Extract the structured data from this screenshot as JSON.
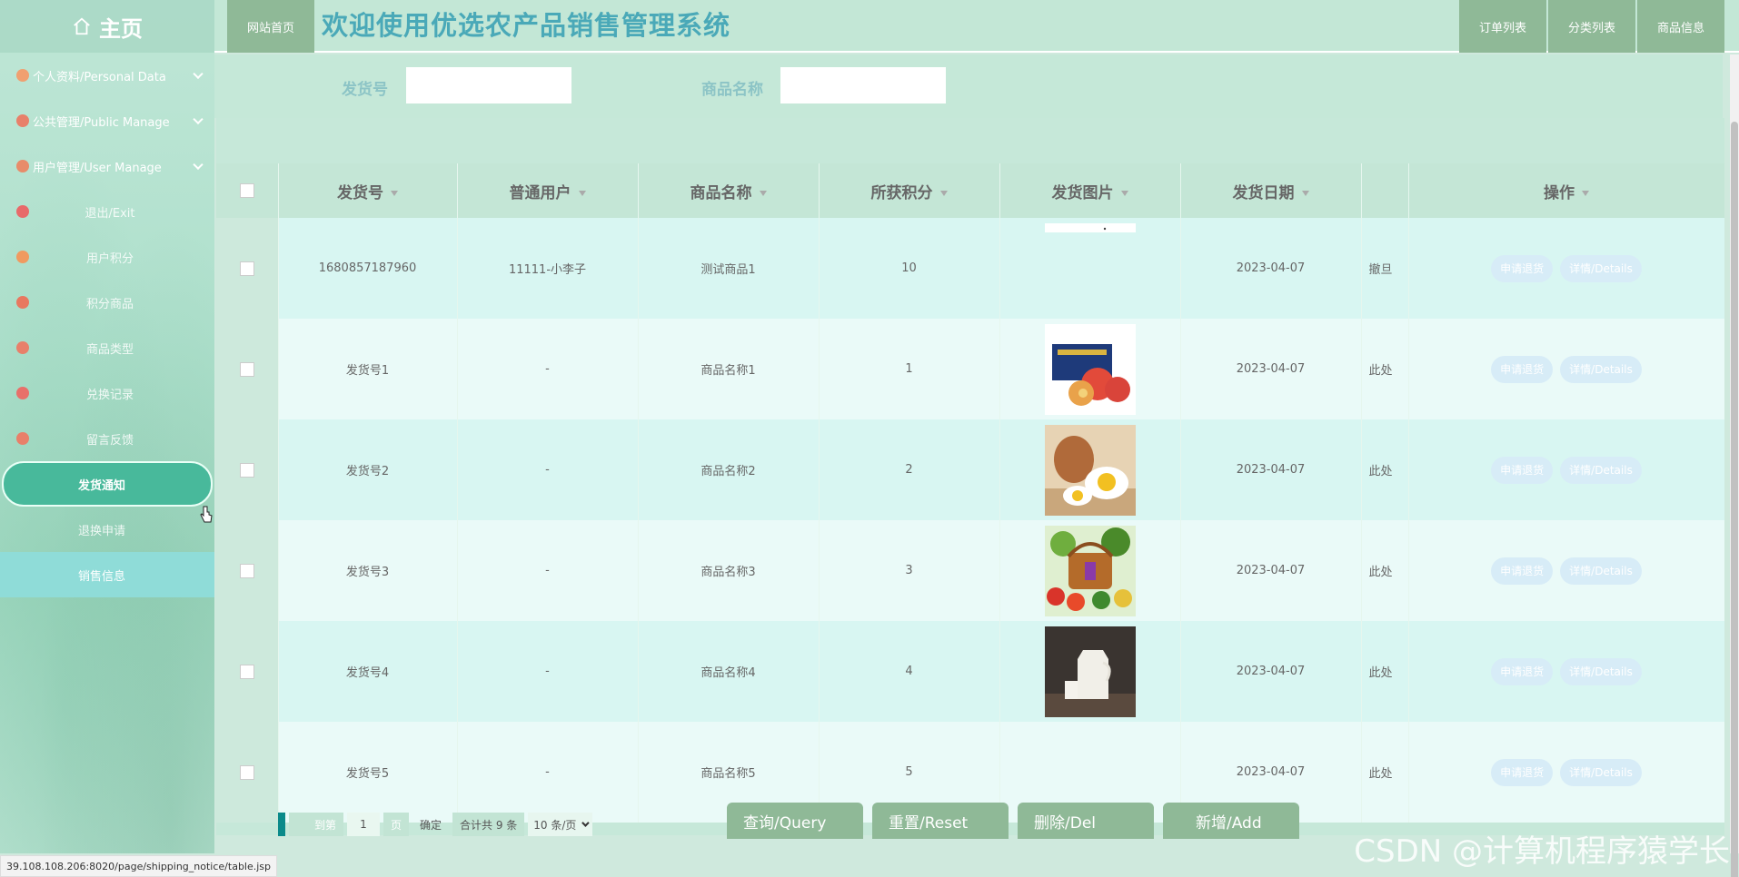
{
  "sidebar": {
    "home": "主页",
    "items": [
      {
        "label": "个人资料/Personal Data",
        "has_sub": true
      },
      {
        "label": "公共管理/Public Manage",
        "has_sub": true
      },
      {
        "label": "用户管理/User Manage",
        "has_sub": true
      },
      {
        "label": "退出/Exit"
      },
      {
        "label": "用户积分"
      },
      {
        "label": "积分商品"
      },
      {
        "label": "商品类型"
      },
      {
        "label": "兑换记录"
      },
      {
        "label": "留言反馈"
      },
      {
        "label": "发货通知",
        "active": true
      },
      {
        "label": "退换申请"
      },
      {
        "label": "销售信息",
        "highlight": true
      }
    ]
  },
  "header": {
    "site_home": "网站首页",
    "title": "欢迎使用优选农产品销售管理系统",
    "nav": [
      "订单列表",
      "分类列表",
      "商品信息"
    ]
  },
  "search": {
    "ship_no_label": "发货号",
    "ship_no_value": "",
    "product_label": "商品名称",
    "product_value": ""
  },
  "table": {
    "columns": [
      "发货号",
      "普通用户",
      "商品名称",
      "所获积分",
      "发货图片",
      "发货日期",
      "",
      "操作"
    ],
    "rows": [
      {
        "ship_no": "1680857187960",
        "user": "11111-小李子",
        "product": "测试商品1",
        "points": "10",
        "image": "blank",
        "date": "2023-04-07",
        "note": "撤旦"
      },
      {
        "ship_no": "发货号1",
        "user": "-",
        "product": "商品名称1",
        "points": "1",
        "image": "apples-box",
        "date": "2023-04-07",
        "note": "此处"
      },
      {
        "ship_no": "发货号2",
        "user": "-",
        "product": "商品名称2",
        "points": "2",
        "image": "eggs",
        "date": "2023-04-07",
        "note": "此处"
      },
      {
        "ship_no": "发货号3",
        "user": "-",
        "product": "商品名称3",
        "points": "3",
        "image": "vegetable-basket",
        "date": "2023-04-07",
        "note": "此处"
      },
      {
        "ship_no": "发货号4",
        "user": "-",
        "product": "商品名称4",
        "points": "4",
        "image": "milk-jug",
        "date": "2023-04-07",
        "note": "此处"
      },
      {
        "ship_no": "发货号5",
        "user": "-",
        "product": "商品名称5",
        "points": "5",
        "image": "none",
        "date": "2023-04-07",
        "note": "此处"
      }
    ],
    "row_actions": [
      "申请退货",
      "详情/Details"
    ]
  },
  "pager": {
    "goto": "到第",
    "page": "1",
    "page_unit": "页",
    "confirm": "确定",
    "total": "合计共 9 条",
    "per_page": "10 条/页"
  },
  "actions": [
    "查询/Query",
    "重置/Reset",
    "删除/Del",
    "新增/Add"
  ],
  "status_url": "39.108.108.206:8020/page/shipping_notice/table.jsp",
  "watermark": "CSDN @计算机程序猿学长",
  "colors": {
    "accent": "#48b99b",
    "button": "#8fb997",
    "title": "#4aa9b8"
  }
}
